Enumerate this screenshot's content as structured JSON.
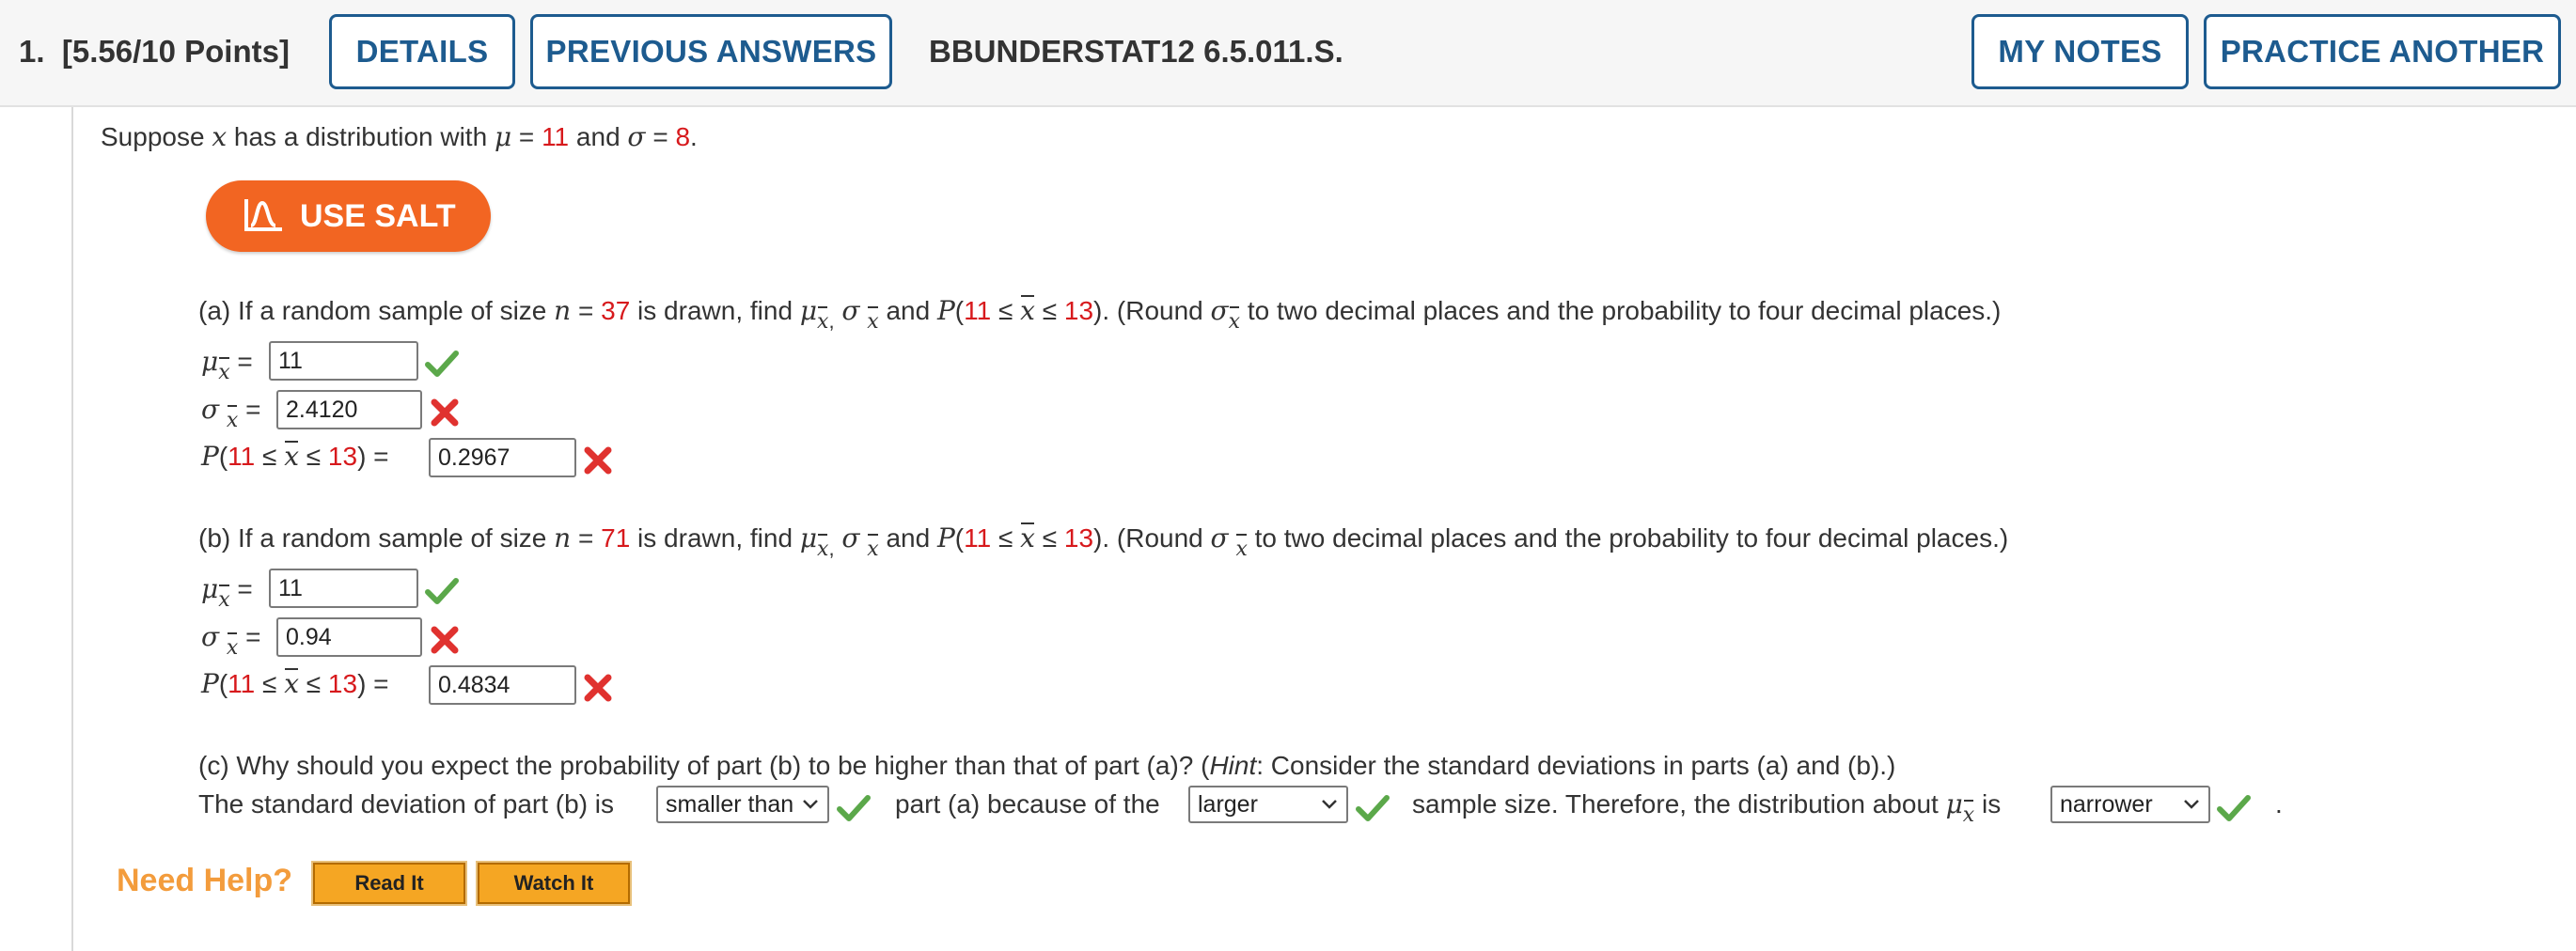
{
  "header": {
    "question_number": "1.",
    "points": "[5.56/10 Points]",
    "details_btn": "DETAILS",
    "prev_answers_btn": "PREVIOUS ANSWERS",
    "question_code": "BBUNDERSTAT12 6.5.011.S.",
    "my_notes_btn": "MY NOTES",
    "practice_btn": "PRACTICE ANOTHER"
  },
  "intro": {
    "text1": "Suppose ",
    "var_x": "x",
    "text2": " has a distribution with ",
    "mu": "μ",
    "eq": " = ",
    "mu_value": "11",
    "and": " and ",
    "sigma": "σ",
    "sigma_value": "8",
    "end": "."
  },
  "salt_button": "USE SALT",
  "part_a": {
    "prompt_pre": "(a) If a random sample of size ",
    "n_var": "n",
    "n_eq": " = ",
    "n_value": "37",
    "prompt_mid": " is drawn, find ",
    "and_p": " and ",
    "prob_low": "11",
    "prob_high": "13",
    "round_pre": "). (Round ",
    "round_post": " to two decimal places and the probability to four decimal places.)",
    "mu_answer": "11",
    "sigma_answer": "2.4120",
    "prob_answer": "0.2967"
  },
  "part_b": {
    "prompt_pre": "(b) If a random sample of size ",
    "n_var": "n",
    "n_eq": " = ",
    "n_value": "71",
    "prompt_mid": " is drawn, find ",
    "and_p": " and ",
    "prob_low": "11",
    "prob_high": "13",
    "round_pre": "). (Round ",
    "round_post": " to two decimal places and the probability to four decimal places.)",
    "mu_answer": "11",
    "sigma_answer": "0.94",
    "prob_answer": "0.4834"
  },
  "part_c": {
    "prompt_pre": "(c) Why should you expect the probability of part (b) to be higher than that of part (a)? (",
    "hint": "Hint",
    "prompt_post": ": Consider the standard deviations in parts (a) and (b).)",
    "line_pre": "The standard deviation of part (b) is",
    "line_mid": "part (a) because of the",
    "line_mid2": "sample size. Therefore, the distribution about",
    "line_is": "is",
    "line_end": ".",
    "select1_value": "smaller than",
    "select2_value": "larger",
    "select3_value": "narrower"
  },
  "help": {
    "label": "Need Help?",
    "read_it": "Read It",
    "watch_it": "Watch It"
  },
  "colors": {
    "accent_blue": "#1d5b8f",
    "salt_orange": "#f26522",
    "value_red": "#d7191c",
    "correct_green": "#5ba84a",
    "wrong_red": "#e0322f"
  }
}
